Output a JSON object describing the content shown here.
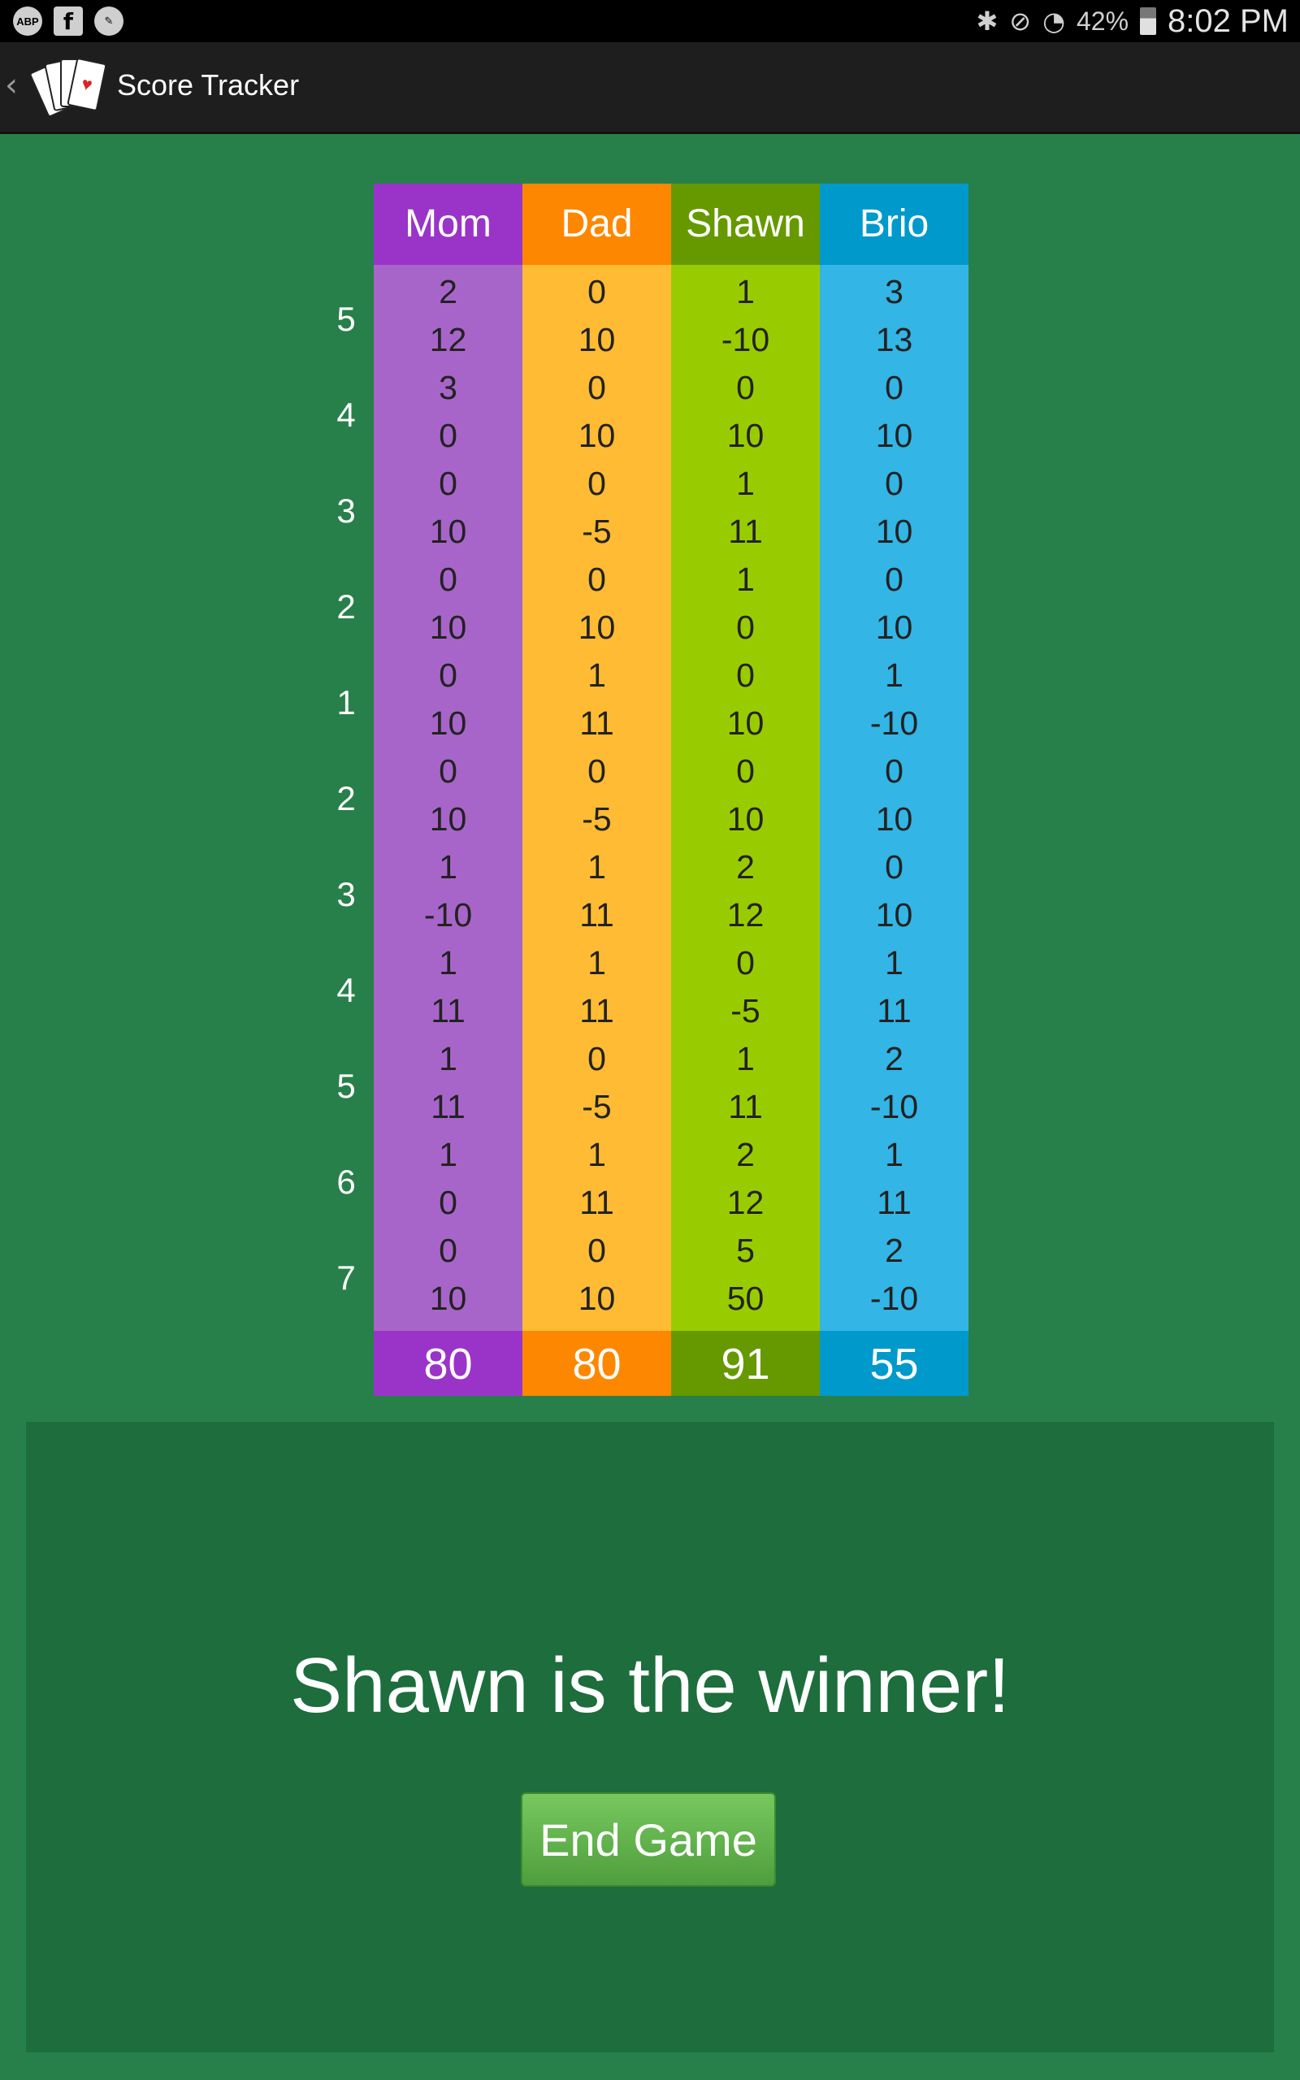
{
  "status_bar": {
    "left_icons": [
      "ABP",
      "f",
      "✎"
    ],
    "battery_text": "42%",
    "time": "8:02 PM"
  },
  "app": {
    "title": "Score Tracker"
  },
  "round_labels": [
    "5",
    "4",
    "3",
    "2",
    "1",
    "2",
    "3",
    "4",
    "5",
    "6",
    "7"
  ],
  "players": [
    {
      "name": "Mom",
      "head_color": "#9a34c8",
      "body_color": "#a865c9",
      "cells": [
        "2",
        "12",
        "3",
        "0",
        "0",
        "10",
        "0",
        "10",
        "0",
        "10",
        "0",
        "10",
        "1",
        "-10",
        "1",
        "11",
        "1",
        "11",
        "1",
        "0",
        "0",
        "10"
      ],
      "total": "80"
    },
    {
      "name": "Dad",
      "head_color": "#fe8700",
      "body_color": "#ffbb33",
      "cells": [
        "0",
        "10",
        "0",
        "10",
        "0",
        "-5",
        "0",
        "10",
        "1",
        "11",
        "0",
        "-5",
        "1",
        "11",
        "1",
        "11",
        "0",
        "-5",
        "1",
        "11",
        "0",
        "10"
      ],
      "total": "80"
    },
    {
      "name": "Shawn",
      "head_color": "#669900",
      "body_color": "#99cc00",
      "cells": [
        "1",
        "-10",
        "0",
        "10",
        "1",
        "11",
        "1",
        "0",
        "0",
        "10",
        "0",
        "10",
        "2",
        "12",
        "0",
        "-5",
        "1",
        "11",
        "2",
        "12",
        "5",
        "50"
      ],
      "total": "91"
    },
    {
      "name": "Brio",
      "head_color": "#0099cc",
      "body_color": "#33b5e5",
      "cells": [
        "3",
        "13",
        "0",
        "10",
        "0",
        "10",
        "0",
        "10",
        "1",
        "-10",
        "0",
        "10",
        "0",
        "10",
        "1",
        "11",
        "2",
        "-10",
        "1",
        "11",
        "2",
        "-10"
      ],
      "total": "55"
    }
  ],
  "winner_text": "Shawn is the winner!",
  "end_button_label": "End Game"
}
